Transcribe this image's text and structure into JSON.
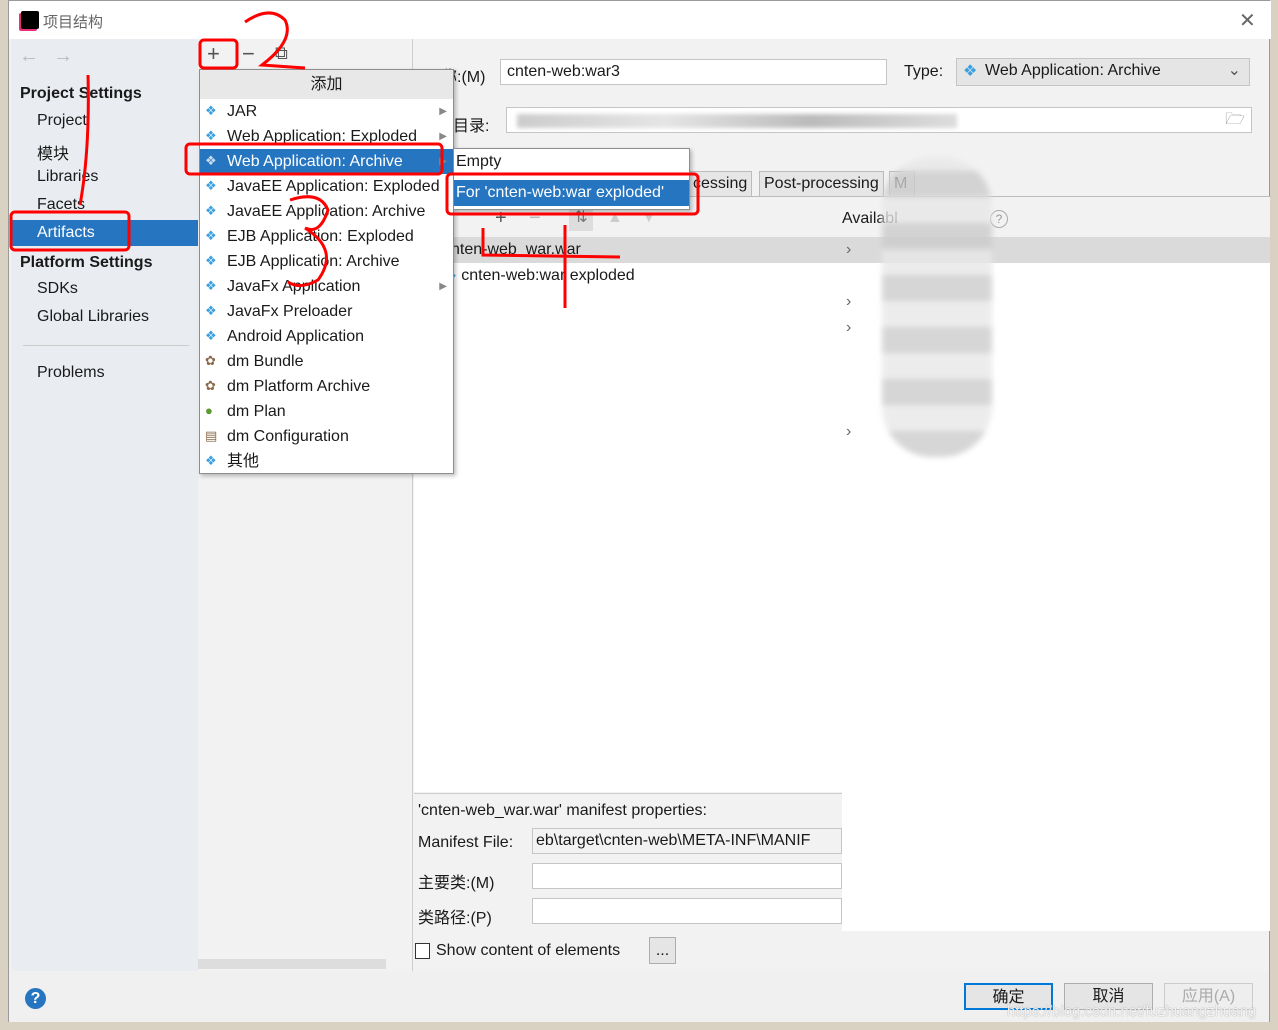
{
  "window": {
    "title": "项目结构",
    "icon": "intellij-icon"
  },
  "sidebar": {
    "back": "←",
    "forward": "→",
    "project_settings": "Project Settings",
    "items": [
      "Project",
      "模块",
      "Libraries",
      "Facets",
      "Artifacts"
    ],
    "platform_settings": "Platform Settings",
    "platform_items": [
      "SDKs",
      "Global Libraries"
    ],
    "problems": "Problems",
    "selected": "Artifacts"
  },
  "toolbar": {
    "add": "+",
    "remove": "−",
    "copy": "⧉"
  },
  "add_menu": {
    "header": "添加",
    "items": [
      {
        "label": "JAR",
        "icon": "jar-icon",
        "submenu": true
      },
      {
        "label": "Web Application: Exploded",
        "icon": "web-icon",
        "submenu": true
      },
      {
        "label": "Web Application: Archive",
        "icon": "web-icon",
        "submenu": true,
        "selected": true
      },
      {
        "label": "JavaEE Application: Exploded",
        "icon": "javaee-icon"
      },
      {
        "label": "JavaEE Application: Archive",
        "icon": "javaee-icon"
      },
      {
        "label": "EJB Application: Exploded",
        "icon": "ejb-icon"
      },
      {
        "label": "EJB Application: Archive",
        "icon": "ejb-icon"
      },
      {
        "label": "JavaFx Application",
        "icon": "javafx-icon",
        "submenu": true
      },
      {
        "label": "JavaFx Preloader",
        "icon": "javafx-icon"
      },
      {
        "label": "Android Application",
        "icon": "android-icon"
      },
      {
        "label": "dm Bundle",
        "icon": "bundle-icon"
      },
      {
        "label": "dm Platform Archive",
        "icon": "bundle-icon"
      },
      {
        "label": "dm Plan",
        "icon": "plan-icon"
      },
      {
        "label": "dm Configuration",
        "icon": "config-icon"
      },
      {
        "label": "其他",
        "icon": "other-icon"
      }
    ]
  },
  "sub_menu": {
    "items": [
      "Empty",
      "For 'cnten-web:war exploded'"
    ],
    "selected": 1
  },
  "form": {
    "name_label": "称:(M)",
    "name_value": "cnten-web:war3",
    "type_label": "Type:",
    "type_value": "Web Application: Archive",
    "output_label": "目录:"
  },
  "tabs": [
    "cessing",
    "Post-processing",
    "M"
  ],
  "tree": {
    "root": "nten-web_war.war",
    "child": "cnten-web:war exploded"
  },
  "available": {
    "label": "Availabl",
    "help": "?"
  },
  "manifest": {
    "title": "'cnten-web_war.war' manifest properties:",
    "file_label": "Manifest File:",
    "file_value": "eb\\target\\cnten-web\\META-INF\\MANIF",
    "main_class_label": "主要类:(M)",
    "classpath_label": "类路径:(P)"
  },
  "show_content": {
    "label": "Show content of elements",
    "checked": false,
    "more": "..."
  },
  "footer": {
    "ok": "确定",
    "cancel": "取消",
    "apply": "应用(A)",
    "help": "?"
  },
  "watermark": "https://blog.csdn.net/fuzhuangzhuang",
  "colors": {
    "accent": "#2675c0",
    "annotation": "#ff0000"
  }
}
